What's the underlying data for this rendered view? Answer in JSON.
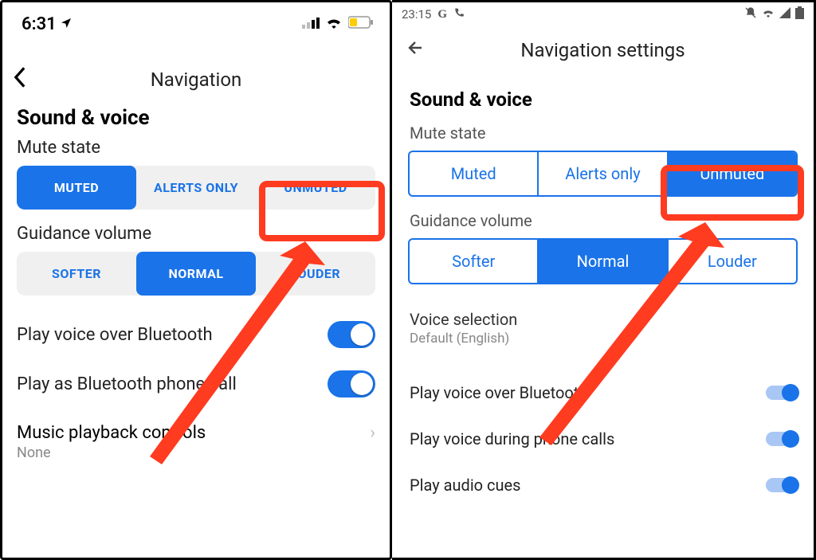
{
  "ios": {
    "time": "6:31",
    "header": "Navigation",
    "section": "Sound & voice",
    "mute_label": "Mute state",
    "mute": {
      "muted": "MUTED",
      "alerts": "ALERTS ONLY",
      "unmuted": "UNMUTED"
    },
    "guidance_label": "Guidance volume",
    "guidance": {
      "softer": "SOFTER",
      "normal": "NORMAL",
      "louder": "LOUDER"
    },
    "bt_voice": "Play voice over Bluetooth",
    "bt_call": "Play as Bluetooth phone call",
    "music_title": "Music playback controls",
    "music_value": "None"
  },
  "android": {
    "time": "23:15",
    "header": "Navigation settings",
    "section": "Sound & voice",
    "mute_label": "Mute state",
    "mute": {
      "muted": "Muted",
      "alerts": "Alerts only",
      "unmuted": "Unmuted"
    },
    "guidance_label": "Guidance volume",
    "guidance": {
      "softer": "Softer",
      "normal": "Normal",
      "louder": "Louder"
    },
    "voice_sel": "Voice selection",
    "voice_sel_val": "Default (English)",
    "rows": {
      "bt": "Play voice over Bluetooth",
      "calls": "Play voice during phone calls",
      "cues": "Play audio cues"
    }
  }
}
